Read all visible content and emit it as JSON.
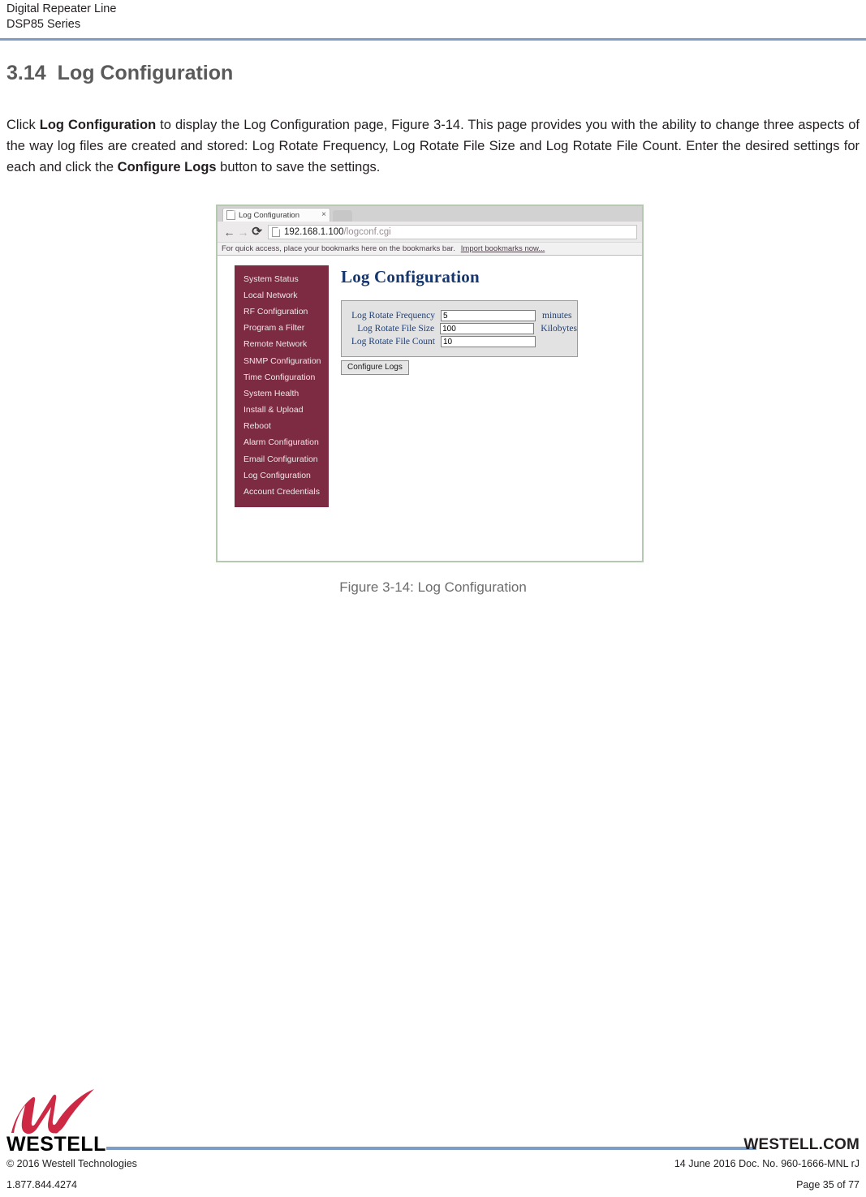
{
  "page_header": {
    "line1": "Digital Repeater Line",
    "line2": "DSP85 Series",
    "rule_color": "#7e9dc4"
  },
  "section": {
    "number": "3.14",
    "title": "Log Configuration",
    "heading_color": "#5a5a5a"
  },
  "body": {
    "text_part1": "Click ",
    "bold1": "Log Configuration",
    "text_part2": " to display the Log Configuration page, Figure 3-14. This page provides you with the ability to change three aspects of the way log files are created and stored: Log Rotate Frequency, Log Rotate File Size and Log Rotate File Count. Enter the desired settings for each and click the ",
    "bold2": "Configure Logs",
    "text_part3": " button to save the settings."
  },
  "browser": {
    "tab": {
      "title": "Log Configuration",
      "favicon": "page-icon",
      "close": "×"
    },
    "nav": {
      "back": "←",
      "forward": "→",
      "reload": "⟳"
    },
    "omnibox": {
      "host": "192.168.1.100",
      "path": "/logconf.cgi",
      "favicon": "page-icon"
    },
    "bookmarks_bar": {
      "text": "For quick access, place your bookmarks here on the bookmarks bar.",
      "link": "Import bookmarks now..."
    }
  },
  "device_ui": {
    "sidebar": {
      "bg_color": "#7d2b42",
      "items": [
        {
          "label": "System Status"
        },
        {
          "label": "Local Network"
        },
        {
          "label": "RF Configuration"
        },
        {
          "label": "Program a Filter"
        },
        {
          "label": "Remote Network"
        },
        {
          "label": "SNMP Configuration"
        },
        {
          "label": "Time Configuration"
        },
        {
          "label": "System Health"
        },
        {
          "label": "Install & Upload"
        },
        {
          "label": "Reboot"
        },
        {
          "label": "Alarm Configuration"
        },
        {
          "label": "Email Configuration"
        },
        {
          "label": "Log Configuration"
        },
        {
          "label": "Account Credentials"
        }
      ]
    },
    "main": {
      "title": "Log Configuration",
      "title_color": "#15366e",
      "fields": [
        {
          "label": "Log Rotate Frequency",
          "value": "5",
          "unit": "minutes"
        },
        {
          "label": "Log Rotate File Size",
          "value": "100",
          "unit": "Kilobytes"
        },
        {
          "label": "Log Rotate File Count",
          "value": "10",
          "unit": ""
        }
      ],
      "submit_button": "Configure Logs"
    }
  },
  "figure": {
    "caption": "Figure 3-14: Log Configuration"
  },
  "footer": {
    "logo_wordmark": "WESTELL",
    "website": "WESTELL.COM",
    "copyright": "© 2016 Westell Technologies",
    "phone": "1.877.844.4274",
    "doc_info": "14 June 2016 Doc. No. 960-1666-MNL rJ",
    "page_number": "Page 35 of 77",
    "logo_color": "#ce2944",
    "rule_color": "#7e9dc4"
  }
}
